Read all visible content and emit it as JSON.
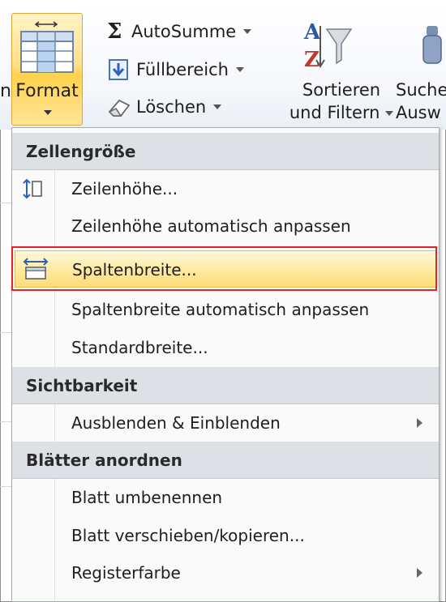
{
  "ribbon": {
    "cut_label": "n",
    "format_label": "Format",
    "autosum_label": "AutoSumme",
    "fill_label": "Füllbereich",
    "clear_label": "Löschen",
    "sort_line1": "Sortieren",
    "sort_line2": "und Filtern",
    "search_line1": "Suche",
    "search_line2": "Ausw"
  },
  "menu": {
    "sections": [
      {
        "title": "Zellengröße"
      },
      {
        "title": "Sichtbarkeit"
      },
      {
        "title": "Blätter anordnen"
      }
    ],
    "items": [
      {
        "label": "Zeilenhöhe..."
      },
      {
        "label": "Zeilenhöhe automatisch anpassen"
      },
      {
        "label": "Spaltenbreite..."
      },
      {
        "label": "Spaltenbreite automatisch anpassen"
      },
      {
        "label": "Standardbreite..."
      },
      {
        "label": "Ausblenden & Einblenden"
      },
      {
        "label": "Blatt umbenennen"
      },
      {
        "label": "Blatt verschieben/kopieren..."
      },
      {
        "label": "Registerfarbe"
      }
    ]
  },
  "colors": {
    "highlight": "#fde89a",
    "annotation_box": "#e2232a",
    "section_bg": "#dde1e6"
  }
}
